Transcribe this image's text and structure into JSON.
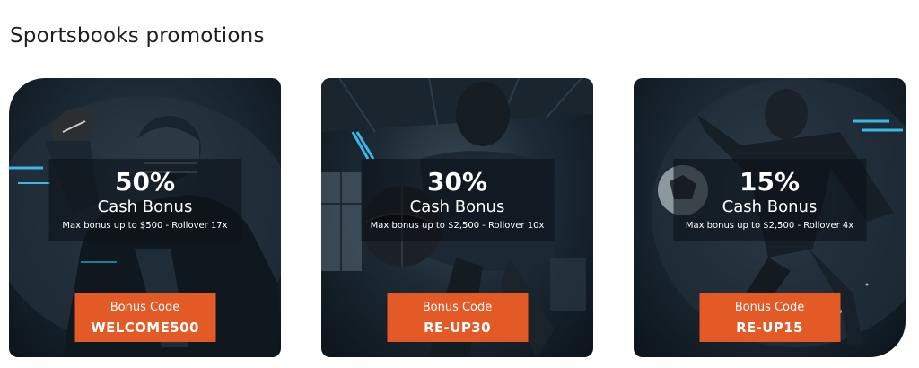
{
  "page": {
    "section_title": "Sportsbooks promotions"
  },
  "colors": {
    "accent": "#e35a26",
    "card_dark": "#0c141b",
    "streak": "#39b8ea"
  },
  "promotions": [
    {
      "sport_image": "american-football-player",
      "percent": "50%",
      "title": "Cash Bonus",
      "terms": "Max bonus up to $500 - Rollover 17x",
      "code_label": "Bonus Code",
      "code": "WELCOME500"
    },
    {
      "sport_image": "basketball-player",
      "percent": "30%",
      "title": "Cash Bonus",
      "terms": "Max bonus up to $2,500 - Rollover 10x",
      "code_label": "Bonus Code",
      "code": "RE-UP30"
    },
    {
      "sport_image": "soccer-player",
      "percent": "15%",
      "title": "Cash Bonus",
      "terms": "Max bonus up to $2,500 - Rollover 4x",
      "code_label": "Bonus Code",
      "code": "RE-UP15"
    }
  ]
}
